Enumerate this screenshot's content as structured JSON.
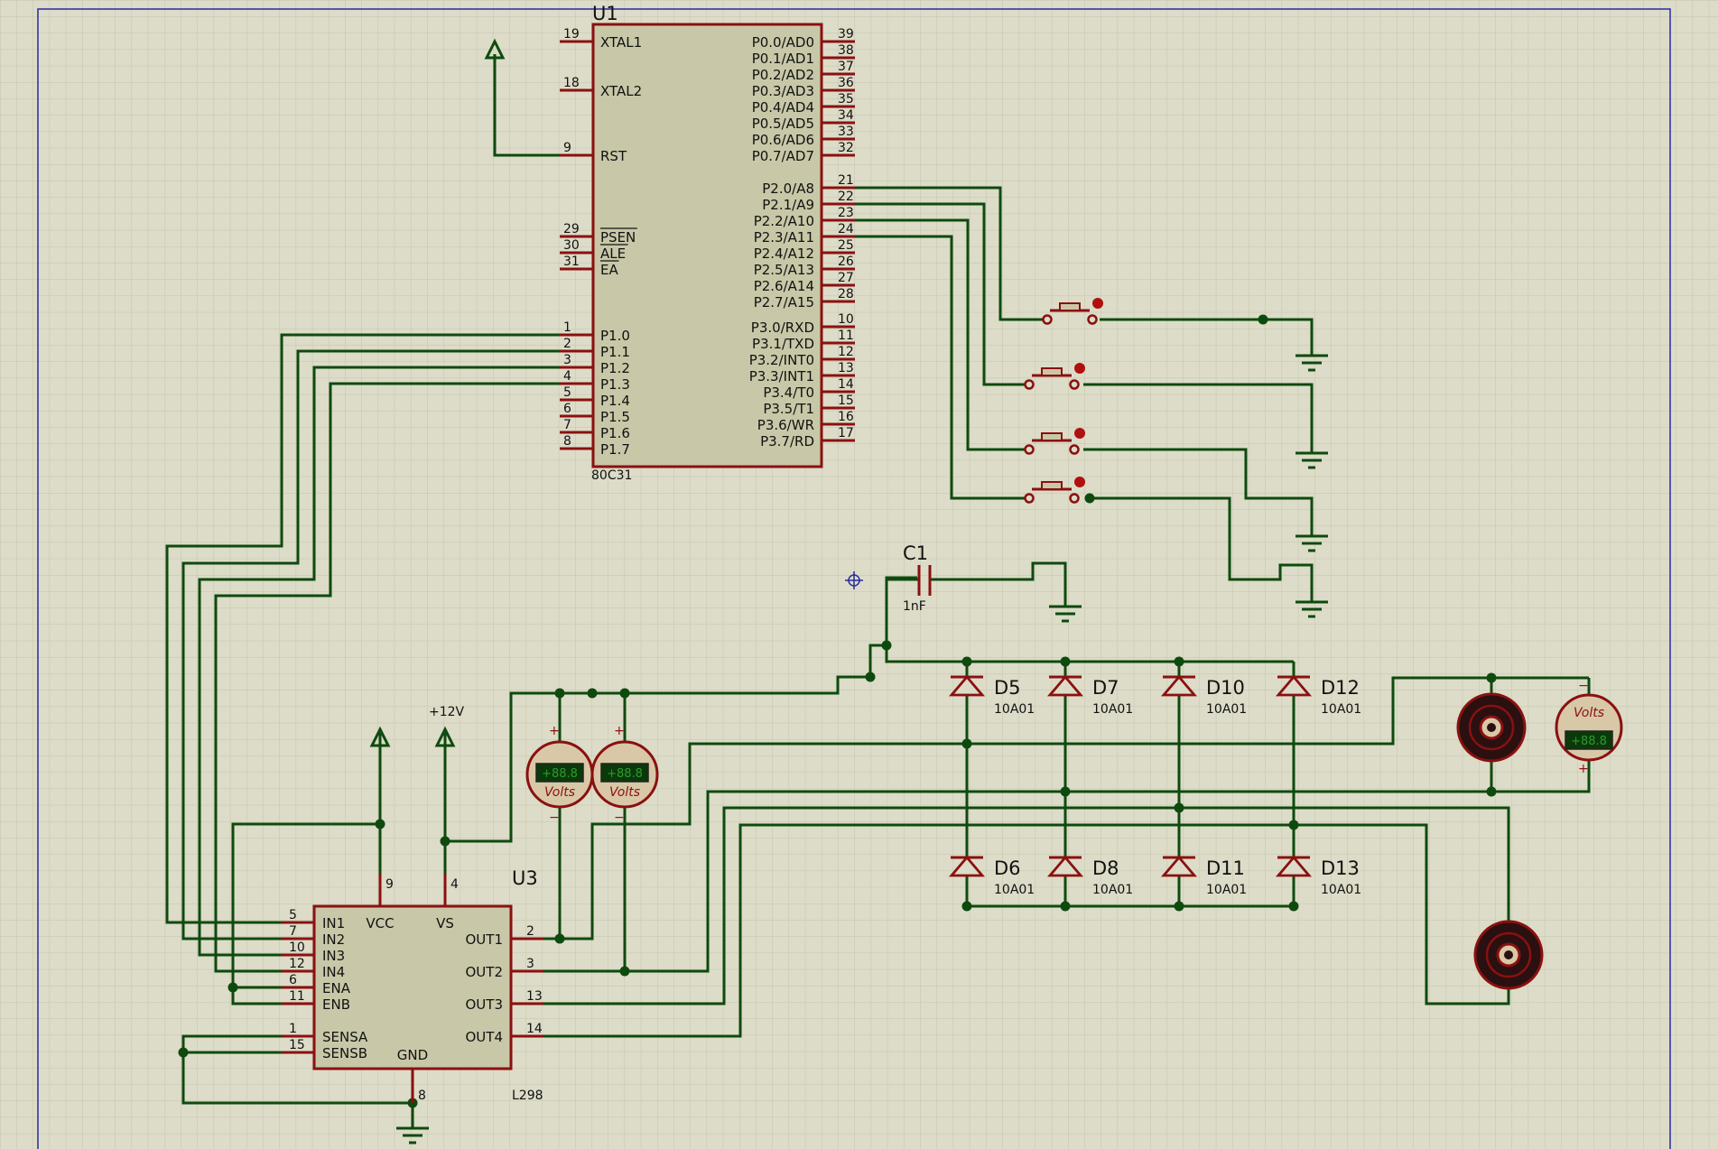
{
  "u1": {
    "ref": "U1",
    "part": "80C31",
    "left_pins": [
      {
        "num": "19",
        "label": "XTAL1"
      },
      {
        "num": "18",
        "label": "XTAL2"
      },
      {
        "num": "9",
        "label": "RST"
      },
      {
        "num": "29",
        "label": "PSEN"
      },
      {
        "num": "30",
        "label": "ALE"
      },
      {
        "num": "31",
        "label": "EA"
      },
      {
        "num": "1",
        "label": "P1.0"
      },
      {
        "num": "2",
        "label": "P1.1"
      },
      {
        "num": "3",
        "label": "P1.2"
      },
      {
        "num": "4",
        "label": "P1.3"
      },
      {
        "num": "5",
        "label": "P1.4"
      },
      {
        "num": "6",
        "label": "P1.5"
      },
      {
        "num": "7",
        "label": "P1.6"
      },
      {
        "num": "8",
        "label": "P1.7"
      }
    ],
    "right_pins": [
      {
        "num": "39",
        "label": "P0.0/AD0"
      },
      {
        "num": "38",
        "label": "P0.1/AD1"
      },
      {
        "num": "37",
        "label": "P0.2/AD2"
      },
      {
        "num": "36",
        "label": "P0.3/AD3"
      },
      {
        "num": "35",
        "label": "P0.4/AD4"
      },
      {
        "num": "34",
        "label": "P0.5/AD5"
      },
      {
        "num": "33",
        "label": "P0.6/AD6"
      },
      {
        "num": "32",
        "label": "P0.7/AD7"
      },
      {
        "num": "21",
        "label": "P2.0/A8"
      },
      {
        "num": "22",
        "label": "P2.1/A9"
      },
      {
        "num": "23",
        "label": "P2.2/A10"
      },
      {
        "num": "24",
        "label": "P2.3/A11"
      },
      {
        "num": "25",
        "label": "P2.4/A12"
      },
      {
        "num": "26",
        "label": "P2.5/A13"
      },
      {
        "num": "27",
        "label": "P2.6/A14"
      },
      {
        "num": "28",
        "label": "P2.7/A15"
      },
      {
        "num": "10",
        "label": "P3.0/RXD"
      },
      {
        "num": "11",
        "label": "P3.1/TXD"
      },
      {
        "num": "12",
        "label": "P3.2/INT0"
      },
      {
        "num": "13",
        "label": "P3.3/INT1"
      },
      {
        "num": "14",
        "label": "P3.4/T0"
      },
      {
        "num": "15",
        "label": "P3.5/T1"
      },
      {
        "num": "16",
        "label": "P3.6/WR"
      },
      {
        "num": "17",
        "label": "P3.7/RD"
      }
    ]
  },
  "u3": {
    "ref": "U3",
    "part": "L298",
    "left_pins": [
      {
        "num": "5",
        "label": "IN1"
      },
      {
        "num": "7",
        "label": "IN2"
      },
      {
        "num": "10",
        "label": "IN3"
      },
      {
        "num": "12",
        "label": "IN4"
      },
      {
        "num": "6",
        "label": "ENA"
      },
      {
        "num": "11",
        "label": "ENB"
      },
      {
        "num": "1",
        "label": "SENSA"
      },
      {
        "num": "15",
        "label": "SENSB"
      }
    ],
    "right_pins": [
      {
        "num": "2",
        "label": "OUT1"
      },
      {
        "num": "3",
        "label": "OUT2"
      },
      {
        "num": "13",
        "label": "OUT3"
      },
      {
        "num": "14",
        "label": "OUT4"
      }
    ],
    "top_pins": [
      {
        "num": "9",
        "label": "VCC"
      },
      {
        "num": "4",
        "label": "VS"
      }
    ],
    "bottom_pin": {
      "num": "8",
      "label": "GND"
    }
  },
  "supply_label": "+12V",
  "capacitor": {
    "ref": "C1",
    "value": "1nF"
  },
  "diodes": [
    {
      "ref": "D5",
      "value": "10A01"
    },
    {
      "ref": "D7",
      "value": "10A01"
    },
    {
      "ref": "D10",
      "value": "10A01"
    },
    {
      "ref": "D12",
      "value": "10A01"
    },
    {
      "ref": "D6",
      "value": "10A01"
    },
    {
      "ref": "D8",
      "value": "10A01"
    },
    {
      "ref": "D11",
      "value": "10A01"
    },
    {
      "ref": "D13",
      "value": "10A01"
    }
  ],
  "voltmeters": [
    {
      "unit": "Volts",
      "reading": "+88.8",
      "plus": "+",
      "minus": "−"
    },
    {
      "unit": "Volts",
      "reading": "+88.8",
      "plus": "+",
      "minus": "−"
    },
    {
      "unit": "Volts",
      "reading": "+88.8",
      "plus": "+",
      "minus": "−"
    }
  ],
  "motors": [
    {
      "name": "motor-1"
    },
    {
      "name": "motor-2"
    }
  ],
  "switch_count": 4
}
